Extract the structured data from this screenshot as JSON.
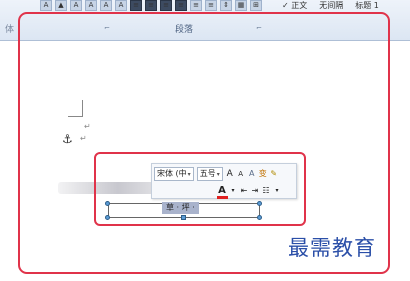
{
  "ribbon": {
    "group_left_label": "体",
    "group_paragraph_label": "段落",
    "dialog_launcher_glyph": "⌐",
    "top_buttons": [
      "A",
      "▲",
      "A",
      "A",
      "A",
      "A",
      "≡",
      "≡",
      "≡",
      "≡",
      "≡",
      "≡",
      "⇕",
      "▦",
      "⊞"
    ],
    "right_items": [
      "✓ 正文",
      "无间隔",
      "标题 1"
    ]
  },
  "document": {
    "paragraph_mark": "↵",
    "anchor_glyph": "⚓"
  },
  "mini_toolbar": {
    "font_name": "宋体 (中",
    "font_size": "五号",
    "grow_font": "A",
    "shrink_font": "A",
    "highlight": "A",
    "phonetic": "变",
    "format_painter": "✎",
    "font_color": "A",
    "decrease_indent": "⇤",
    "increase_indent": "⇥",
    "bullets": "☷"
  },
  "textbox": {
    "selected_text": "草 · 坪 ·"
  },
  "watermark": "最需教育"
}
